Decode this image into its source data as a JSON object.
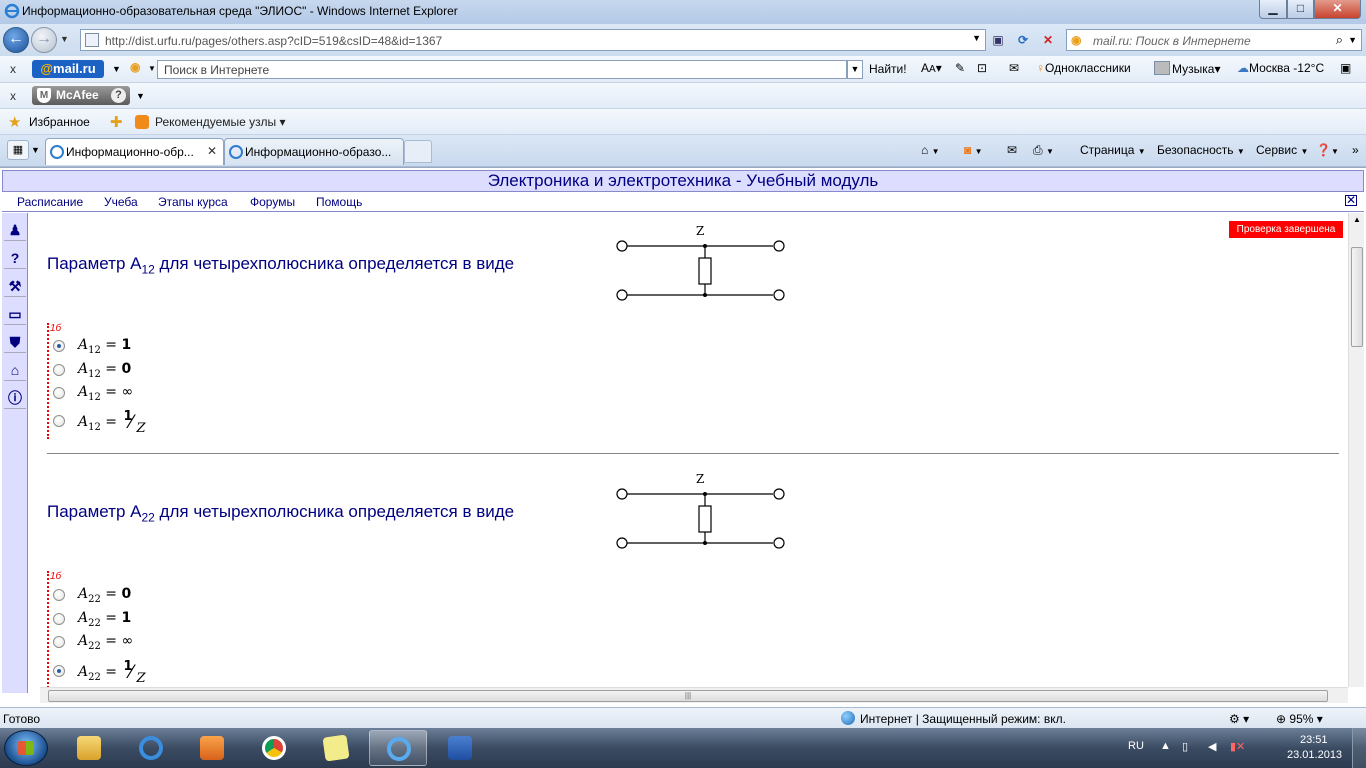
{
  "window": {
    "title": "Информационно-образовательная среда \"ЭЛИОС\" - Windows Internet Explorer",
    "min_glyph": "▁",
    "max_glyph": "□",
    "close_glyph": "✕"
  },
  "address_bar": {
    "url": "http://dist.urfu.ru/pages/others.asp?cID=519&csID=48&id=1367",
    "search_placeholder": "mail.ru: Поиск в Интернете"
  },
  "mail_toolbar": {
    "logo_at": "@",
    "logo_text": "mail.ru",
    "search_placeholder": "Поиск в Интернете",
    "find_label": "Найти!",
    "odnoklassniki": "Одноклассники",
    "music": "Музыка",
    "weather": "Москва -12°C"
  },
  "mcafee_toolbar": {
    "logo": "McAfee",
    "help": "?"
  },
  "favorites_bar": {
    "favorites": "Избранное",
    "recommended": "Рекомендуемые узлы"
  },
  "tabs": [
    {
      "label": "Информационно-обр..."
    },
    {
      "label": "Информационно-образо..."
    }
  ],
  "commands": {
    "page": "Страница",
    "safety": "Безопасность",
    "tools": "Сервис"
  },
  "page": {
    "module_title": "Электроника и электротехника - Учебный модуль",
    "menu": [
      "Расписание",
      "Учеба",
      "Этапы курса",
      "Форумы",
      "Помощь"
    ],
    "status_badge": "Проверка завершена",
    "questions": [
      {
        "title_prefix": "Параметр A",
        "title_sub": "12",
        "title_suffix": " для четырехполюсника определяется в виде",
        "circuit_label": "Z",
        "score": "1б",
        "options": [
          {
            "var": "A",
            "sub": "12",
            "eq": " = ",
            "value": "1",
            "fraction": false,
            "selected": true
          },
          {
            "var": "A",
            "sub": "12",
            "eq": " = ",
            "value": "0",
            "fraction": false,
            "selected": false
          },
          {
            "var": "A",
            "sub": "12",
            "eq": " = ",
            "value": "∞",
            "fraction": false,
            "selected": false
          },
          {
            "var": "A",
            "sub": "12",
            "eq": " = ",
            "num": "1",
            "den": "Z",
            "fraction": true,
            "selected": false
          }
        ]
      },
      {
        "title_prefix": "Параметр A",
        "title_sub": "22",
        "title_suffix": " для четырехполюсника определяется в виде",
        "circuit_label": "Z",
        "score": "1б",
        "options": [
          {
            "var": "A",
            "sub": "22",
            "eq": " = ",
            "value": "0",
            "fraction": false,
            "selected": false
          },
          {
            "var": "A",
            "sub": "22",
            "eq": " = ",
            "value": "1",
            "fraction": false,
            "selected": false
          },
          {
            "var": "A",
            "sub": "22",
            "eq": " = ",
            "value": "∞",
            "fraction": false,
            "selected": false
          },
          {
            "var": "A",
            "sub": "22",
            "eq": " = ",
            "num": "1",
            "den": "Z",
            "fraction": true,
            "selected": true
          }
        ]
      }
    ]
  },
  "statusbar": {
    "left": "Готово",
    "zone": "Интернет | Защищенный режим: вкл.",
    "zoom": "95%"
  },
  "taskbar": {
    "lang": "RU",
    "time": "23:51",
    "date": "23.01.2013"
  }
}
